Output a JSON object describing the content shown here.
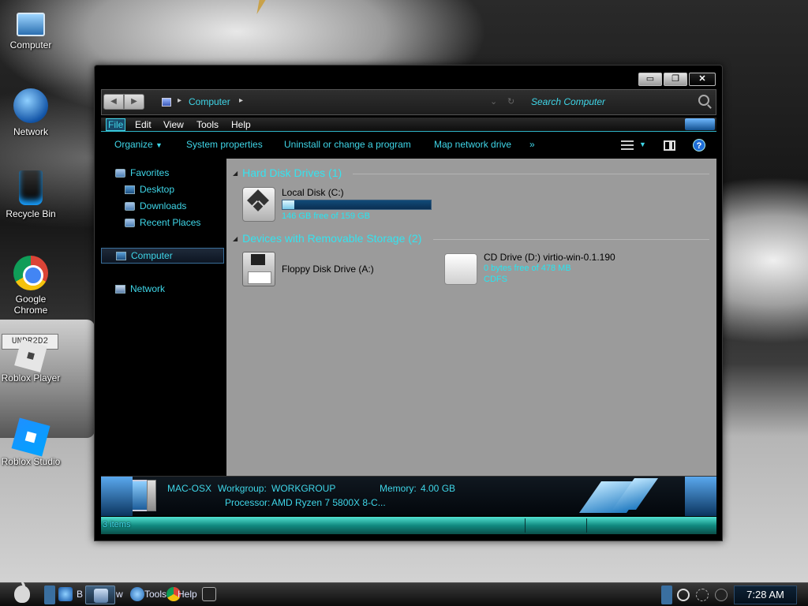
{
  "desktop": {
    "icons": [
      {
        "label": "Computer",
        "icon": "computer-icon"
      },
      {
        "label": "Network",
        "icon": "network-icon"
      },
      {
        "label": "Recycle Bin",
        "icon": "recycle-bin-icon"
      },
      {
        "label": "Google Chrome",
        "icon": "chrome-icon"
      },
      {
        "label": "Roblox Player",
        "icon": "roblox-player-icon"
      },
      {
        "label": "Roblox Studio",
        "icon": "roblox-studio-icon"
      }
    ],
    "wallpaper_plate": "UNDR2D2"
  },
  "window": {
    "controls": {
      "minimize": "▭",
      "maximize": "❐",
      "close": "✕"
    },
    "address": {
      "back": "◀",
      "forward": "▶",
      "crumb_sep": "▸",
      "location": "Computer",
      "dropdown": "⌄",
      "refresh": "↻",
      "search_placeholder": "Search Computer"
    },
    "menu": [
      "File",
      "Edit",
      "View",
      "Tools",
      "Help"
    ],
    "toolbar": {
      "organize": "Organize",
      "caret": "▼",
      "system_properties": "System properties",
      "uninstall": "Uninstall or change a program",
      "map_drive": "Map network drive",
      "more": "»",
      "help": "?"
    },
    "nav": {
      "favorites": "Favorites",
      "desktop": "Desktop",
      "downloads": "Downloads",
      "recent": "Recent Places",
      "computer": "Computer",
      "network": "Network"
    },
    "groups": {
      "hdd": {
        "title": "Hard Disk Drives (1)",
        "collapse": "◢"
      },
      "removable": {
        "title": "Devices with Removable Storage (2)",
        "collapse": "◢"
      }
    },
    "drives": {
      "c": {
        "name": "Local Disk (C:)",
        "free": "146 GB free of 159 GB",
        "used_fraction": 0.082
      },
      "a": {
        "name": "Floppy Disk Drive (A:)"
      },
      "d": {
        "name": "CD Drive (D:) virtio-win-0.1.190",
        "free": "0 bytes free of 478 MB",
        "fs": "CDFS"
      }
    },
    "details": {
      "computer_name": "MAC-OSX",
      "workgroup_label": "Workgroup:",
      "workgroup": "WORKGROUP",
      "memory_label": "Memory:",
      "memory": "4.00 GB",
      "processor_label": "Processor:",
      "processor": "AMD Ryzen 7 5800X 8-C..."
    },
    "status": {
      "items": "3 items"
    }
  },
  "taskbar": {
    "labels": [
      "B",
      "w",
      "Tools",
      "Help"
    ],
    "clock": "7:28 AM"
  },
  "colors": {
    "accent": "#3fd6e8",
    "content_bg": "#9b9b9b"
  }
}
